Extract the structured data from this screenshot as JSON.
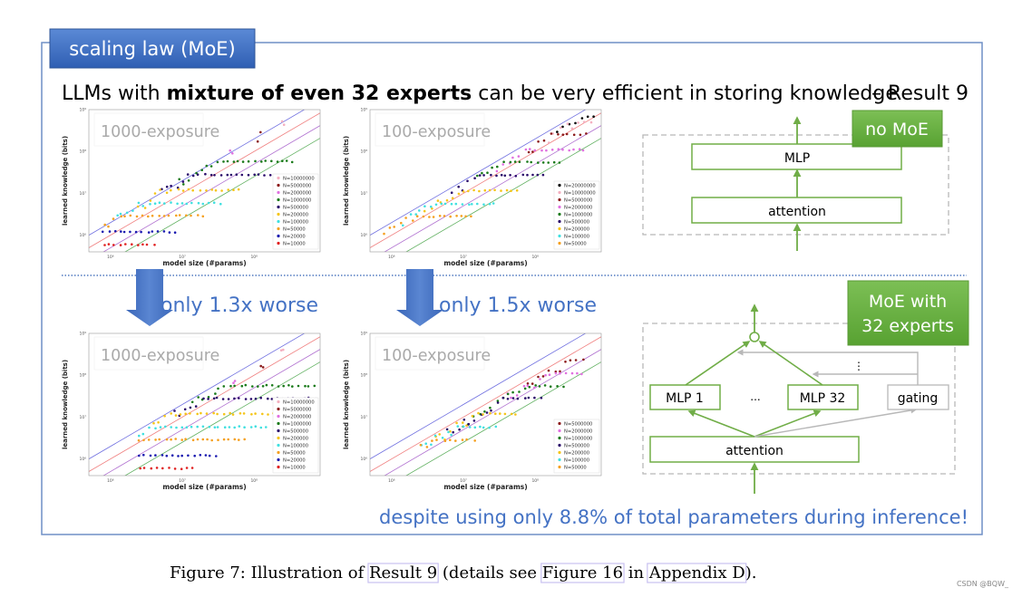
{
  "header": {
    "tab_title": "scaling law (MoE)",
    "headline_pre": "LLMs with ",
    "headline_bold": "mixture of even 32 experts",
    "headline_post": " can be very efficient in storing knowledge",
    "result_tag": "– Result 9"
  },
  "comparisons": [
    {
      "label": "only 1.3x worse"
    },
    {
      "label": "only 1.5x worse"
    }
  ],
  "footer_note": "despite using only 8.8% of total parameters during inference!",
  "diagram_no_moe": {
    "badge": "no MoE",
    "mlp": "MLP",
    "attention": "attention"
  },
  "diagram_moe": {
    "badge_line1": "MoE with",
    "badge_line2": "32 experts",
    "mlp_first": "MLP 1",
    "ellipsis": "...",
    "mlp_last": "MLP 32",
    "gating": "gating",
    "attention": "attention",
    "vertical_ellipsis": "⋮"
  },
  "caption": {
    "prefix": "Figure 7: Illustration of ",
    "link1": "Result 9",
    "middle": " (details see ",
    "link2": "Figure 16",
    "middle2": " in ",
    "link3": "Appendix D",
    "suffix": ")."
  },
  "watermark": "CSDN @BQW_",
  "colors": {
    "frame": "#6f8fc6",
    "accent_blue": "#4472c4",
    "green": "#70ad47",
    "gray_line": "#b0b0b0"
  },
  "chart_data": [
    {
      "type": "scatter",
      "title": "1000-exposure",
      "xlabel": "model size (#params)",
      "ylabel": "learned knowledge (bits)",
      "xscale": "log",
      "yscale": "log",
      "xlim": [
        500000,
        830000000
      ],
      "ylim": [
        400000,
        1000000000
      ],
      "x_ticks": [
        "10⁶",
        "10⁷",
        "10⁸"
      ],
      "y_ticks": [
        "10⁶",
        "10⁷",
        "10⁸",
        "10⁹"
      ],
      "reference_lines_bits_per_param": [
        {
          "value": 2,
          "color": "#7070e0"
        },
        {
          "value": 1,
          "color": "#f08080"
        },
        {
          "value": 0.5,
          "color": "#b070d0"
        },
        {
          "value": 0.25,
          "color": "#60b060"
        }
      ],
      "trend_bits_per_param": 2,
      "legend": "bottom-right",
      "series": [
        {
          "name": "N=10000000",
          "color": "#f4b0c0",
          "plateau_bits": 580000000,
          "x_range": [
            240000000,
            260000000
          ]
        },
        {
          "name": "N=5000000",
          "color": "#8b1a1a",
          "plateau_bits": 290000000,
          "x_range": [
            115000000,
            125000000
          ]
        },
        {
          "name": "N=2000000",
          "color": "#e070e0",
          "plateau_bits": 116000000,
          "x_range": [
            48000000,
            52000000
          ]
        },
        {
          "name": "N=1000000",
          "color": "#1a7a1a",
          "plateau_bits": 58000000,
          "x_range": [
            9000000,
            350000000
          ]
        },
        {
          "name": "N=500000",
          "color": "#2a0a6a",
          "plateau_bits": 28000000,
          "x_range": [
            5000000,
            170000000
          ]
        },
        {
          "name": "N=200000",
          "color": "#f5c518",
          "plateau_bits": 12000000,
          "x_range": [
            2500000,
            60000000
          ]
        },
        {
          "name": "N=100000",
          "color": "#40e0e0",
          "plateau_bits": 5800000,
          "x_range": [
            1200000,
            33000000
          ]
        },
        {
          "name": "N=50000",
          "color": "#f5a020",
          "plateau_bits": 2900000,
          "x_range": [
            800000,
            19000000
          ]
        },
        {
          "name": "N=20000",
          "color": "#1a1ab0",
          "plateau_bits": 1200000,
          "x_range": [
            800000,
            8000000
          ]
        },
        {
          "name": "N=10000",
          "color": "#e02020",
          "plateau_bits": 600000,
          "x_range": [
            800000,
            4000000
          ]
        }
      ]
    },
    {
      "type": "scatter",
      "title": "100-exposure",
      "xlabel": "model size (#params)",
      "ylabel": "learned knowledge (bits)",
      "xscale": "log",
      "yscale": "log",
      "xlim": [
        500000,
        830000000
      ],
      "ylim": [
        400000,
        1000000000
      ],
      "x_ticks": [
        "10⁶",
        "10⁷",
        "10⁸"
      ],
      "y_ticks": [
        "10⁶",
        "10⁷",
        "10⁸",
        "10⁹"
      ],
      "reference_lines_bits_per_param": [
        {
          "value": 2,
          "color": "#7070e0"
        },
        {
          "value": 1,
          "color": "#f08080"
        },
        {
          "value": 0.5,
          "color": "#b070d0"
        },
        {
          "value": 0.25,
          "color": "#60b060"
        }
      ],
      "trend_bits_per_param": 1.4,
      "legend": "bottom-right",
      "series": [
        {
          "name": "N=20000000",
          "color": "#000000",
          "plateau_bits": 700000000,
          "x_range": [
            200000000,
            650000000
          ]
        },
        {
          "name": "N=10000000",
          "color": "#f4b0c0",
          "plateau_bits": 500000000,
          "x_range": [
            150000000,
            600000000
          ]
        },
        {
          "name": "N=5000000",
          "color": "#8b1a1a",
          "plateau_bits": 260000000,
          "x_range": [
            80000000,
            500000000
          ]
        },
        {
          "name": "N=2000000",
          "color": "#e070e0",
          "plateau_bits": 110000000,
          "x_range": [
            30000000,
            480000000
          ]
        },
        {
          "name": "N=1000000",
          "color": "#1a7a1a",
          "plateau_bits": 56000000,
          "x_range": [
            15000000,
            220000000
          ]
        },
        {
          "name": "N=500000",
          "color": "#2a0a6a",
          "plateau_bits": 27000000,
          "x_range": [
            7000000,
            130000000
          ]
        },
        {
          "name": "N=200000",
          "color": "#f5c518",
          "plateau_bits": 11500000,
          "x_range": [
            3000000,
            55000000
          ]
        },
        {
          "name": "N=100000",
          "color": "#40e0e0",
          "plateau_bits": 5600000,
          "x_range": [
            1500000,
            27000000
          ]
        },
        {
          "name": "N=50000",
          "color": "#f5a020",
          "plateau_bits": 2800000,
          "x_range": [
            800000,
            13000000
          ]
        }
      ]
    },
    {
      "type": "scatter",
      "title": "1000-exposure",
      "xlabel": "model size (#params)",
      "ylabel": "learned knowledge (bits)",
      "xscale": "log",
      "yscale": "log",
      "xlim": [
        500000,
        830000000
      ],
      "ylim": [
        400000,
        1000000000
      ],
      "x_ticks": [
        "10⁶",
        "10⁷",
        "10⁸"
      ],
      "y_ticks": [
        "10⁶",
        "10⁷",
        "10⁸",
        "10⁹"
      ],
      "reference_lines_bits_per_param": [
        {
          "value": 2,
          "color": "#7070e0"
        },
        {
          "value": 1,
          "color": "#f08080"
        },
        {
          "value": 0.5,
          "color": "#b070d0"
        },
        {
          "value": 0.25,
          "color": "#60b060"
        }
      ],
      "trend_bits_per_param": 1.5,
      "legend": "bottom-right",
      "series": [
        {
          "name": "N=10000000",
          "color": "#f4b0c0",
          "plateau_bits": 480000000,
          "x_range": [
            240000000,
            260000000
          ]
        },
        {
          "name": "N=5000000",
          "color": "#8b1a1a",
          "plateau_bits": 220000000,
          "x_range": [
            120000000,
            130000000
          ]
        },
        {
          "name": "N=2000000",
          "color": "#e070e0",
          "plateau_bits": 95000000,
          "x_range": [
            52000000,
            56000000
          ]
        },
        {
          "name": "N=1000000",
          "color": "#1a7a1a",
          "plateau_bits": 56000000,
          "x_range": [
            14000000,
            700000000
          ]
        },
        {
          "name": "N=500000",
          "color": "#2a0a6a",
          "plateau_bits": 28000000,
          "x_range": [
            8000000,
            700000000
          ]
        },
        {
          "name": "N=200000",
          "color": "#f5c518",
          "plateau_bits": 12000000,
          "x_range": [
            4000000,
            500000000
          ]
        },
        {
          "name": "N=100000",
          "color": "#40e0e0",
          "plateau_bits": 5800000,
          "x_range": [
            2500000,
            150000000
          ]
        },
        {
          "name": "N=50000",
          "color": "#f5a020",
          "plateau_bits": 2900000,
          "x_range": [
            2500000,
            75000000
          ]
        },
        {
          "name": "N=20000",
          "color": "#1a1ab0",
          "plateau_bits": 1200000,
          "x_range": [
            2500000,
            30000000
          ]
        },
        {
          "name": "N=10000",
          "color": "#e02020",
          "plateau_bits": 600000,
          "x_range": [
            2500000,
            14000000
          ]
        }
      ]
    },
    {
      "type": "scatter",
      "title": "100-exposure",
      "xlabel": "model size (#params)",
      "ylabel": "learned knowledge (bits)",
      "xscale": "log",
      "yscale": "log",
      "xlim": [
        500000,
        830000000
      ],
      "ylim": [
        400000,
        1000000000
      ],
      "x_ticks": [
        "10⁶",
        "10⁷",
        "10⁸"
      ],
      "y_ticks": [
        "10⁶",
        "10⁷",
        "10⁸",
        "10⁹"
      ],
      "reference_lines_bits_per_param": [
        {
          "value": 2,
          "color": "#7070e0"
        },
        {
          "value": 1,
          "color": "#f08080"
        },
        {
          "value": 0.5,
          "color": "#b070d0"
        },
        {
          "value": 0.25,
          "color": "#60b060"
        }
      ],
      "trend_bits_per_param": 0.7,
      "legend": "bottom-right",
      "series": [
        {
          "name": "N=5000000",
          "color": "#8b1a1a",
          "plateau_bits": 230000000,
          "x_range": [
            80000000,
            450000000
          ]
        },
        {
          "name": "N=2000000",
          "color": "#e070e0",
          "plateau_bits": 110000000,
          "x_range": [
            40000000,
            450000000
          ]
        },
        {
          "name": "N=1000000",
          "color": "#1a7a1a",
          "plateau_bits": 55000000,
          "x_range": [
            10000000,
            240000000
          ]
        },
        {
          "name": "N=500000",
          "color": "#2a0a6a",
          "plateau_bits": 28000000,
          "x_range": [
            6000000,
            120000000
          ]
        },
        {
          "name": "N=200000",
          "color": "#f5c518",
          "plateau_bits": 12000000,
          "x_range": [
            4000000,
            55000000
          ]
        },
        {
          "name": "N=100000",
          "color": "#40e0e0",
          "plateau_bits": 5800000,
          "x_range": [
            2500000,
            28000000
          ]
        },
        {
          "name": "N=50000",
          "color": "#f5a020",
          "plateau_bits": 2800000,
          "x_range": [
            2500000,
            14000000
          ]
        }
      ]
    }
  ]
}
